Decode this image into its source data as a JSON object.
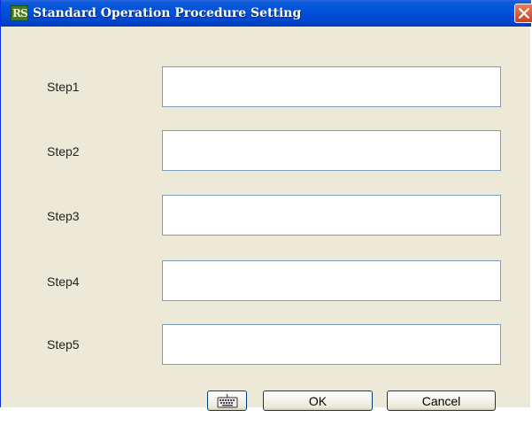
{
  "window": {
    "title": "Standard Operation Procedure Setting",
    "app_icon_text": "RS"
  },
  "steps": [
    {
      "label": "Step1",
      "value": ""
    },
    {
      "label": "Step2",
      "value": ""
    },
    {
      "label": "Step3",
      "value": ""
    },
    {
      "label": "Step4",
      "value": ""
    },
    {
      "label": "Step5",
      "value": ""
    }
  ],
  "buttons": {
    "keyboard_icon": "keyboard-icon",
    "ok_label": "OK",
    "cancel_label": "Cancel"
  },
  "colors": {
    "titlebar": "#0050d8",
    "dialog_background": "#ece9d8",
    "close_button": "#d8552e",
    "input_border": "#7f9db9"
  }
}
